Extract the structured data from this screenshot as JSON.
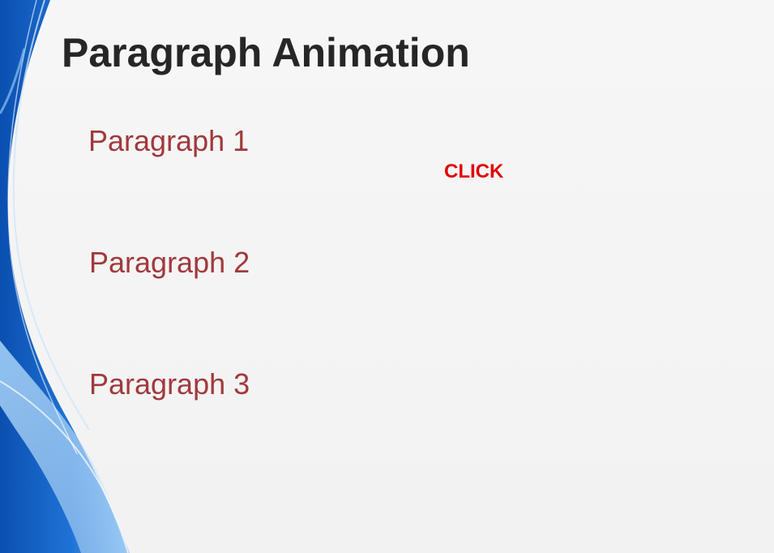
{
  "slide": {
    "title": "Paragraph Animation",
    "paragraphs": [
      {
        "label": "Paragraph 1"
      },
      {
        "label": "Paragraph 2"
      },
      {
        "label": "Paragraph 3"
      }
    ],
    "click_label": "CLICK"
  },
  "colors": {
    "title": "#262626",
    "paragraph": "#a1393c",
    "click": "#e00000",
    "background": "#f4f4f4",
    "wave_blue": "#1f6fd0"
  }
}
